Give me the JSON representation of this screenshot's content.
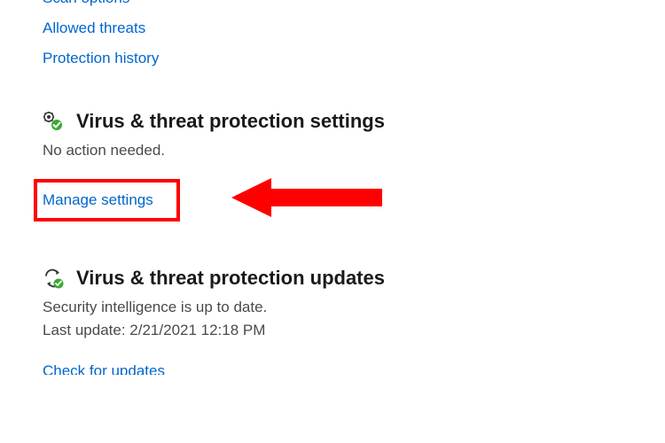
{
  "links": {
    "scan_options": "Scan options",
    "allowed_threats": "Allowed threats",
    "protection_history": "Protection history",
    "manage_settings": "Manage settings",
    "check_for_updates": "Check for updates"
  },
  "sections": {
    "settings": {
      "title": "Virus & threat protection settings",
      "status": "No action needed."
    },
    "updates": {
      "title": "Virus & threat protection updates",
      "status": "Security intelligence is up to date.",
      "last_update": "Last update: 2/21/2021 12:18 PM"
    }
  },
  "colors": {
    "link": "#0066cc",
    "highlight": "#ff0000",
    "check": "#3aaa35"
  }
}
